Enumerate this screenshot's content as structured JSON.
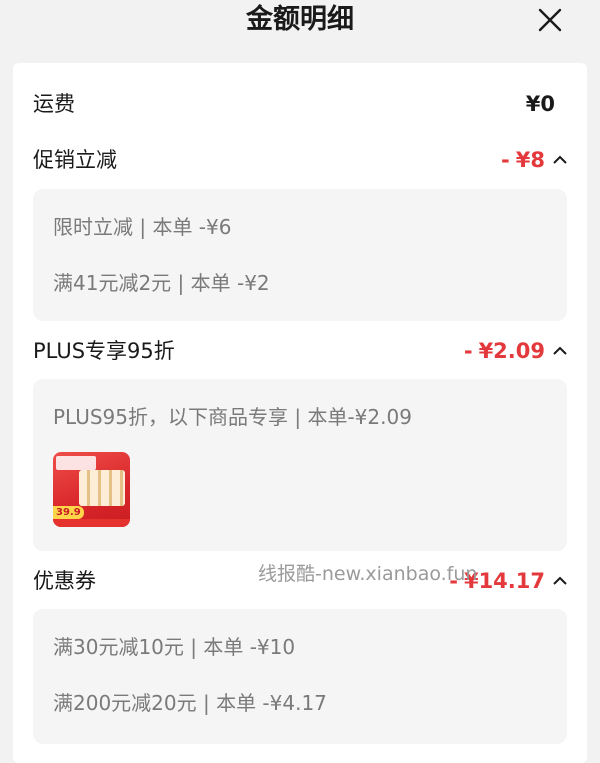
{
  "header": {
    "title": "金额明细"
  },
  "rows": {
    "shipping": {
      "label": "运费",
      "amount": "¥0"
    },
    "promo": {
      "label": "促销立减",
      "dash": "-",
      "amount": "¥8",
      "details": [
        "限时立减 | 本单 -¥6",
        "满41元减2元 | 本单 -¥2"
      ]
    },
    "plus": {
      "label": "PLUS专享95折",
      "dash": "-",
      "amount": "¥2.09",
      "details": [
        "PLUS95折，以下商品专享 | 本单-¥2.09"
      ],
      "product": {
        "price": "39.9"
      }
    },
    "coupon": {
      "label": "优惠券",
      "dash": "-",
      "amount": "¥14.17",
      "details": [
        "满30元减10元 | 本单 -¥10",
        "满200元减20元 | 本单 -¥4.17"
      ]
    }
  },
  "watermark": "线报酷-new.xianbao.fun",
  "colors": {
    "accent": "#e4393c",
    "muted": "#7a7a7a",
    "panel": "#f5f5f5"
  },
  "icons": {
    "close": "close-icon",
    "collapse": "chevron-up-icon"
  }
}
